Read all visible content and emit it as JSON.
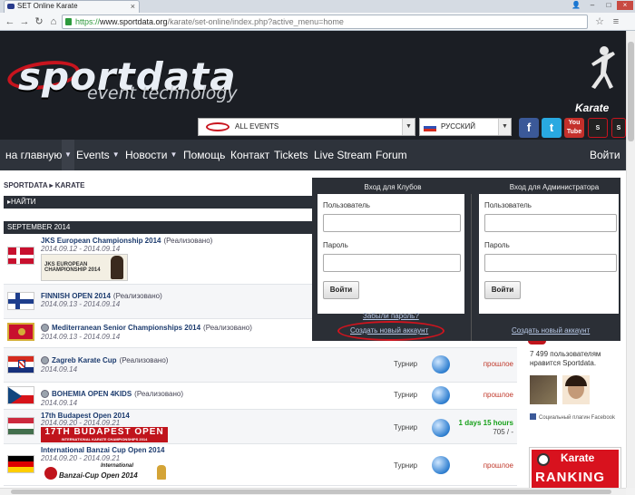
{
  "browser": {
    "tab_title": "SET Online Karate",
    "url_https": "https://",
    "url_host": "www.sportdata.org",
    "url_path": "/karate/set-online/index.php?active_menu=home"
  },
  "header": {
    "logo_main": "sportdata",
    "logo_sub": "event technology",
    "sport_label": "Karate",
    "events_select": "ALL EVENTS",
    "language_select": "РУССКИЙ",
    "social": [
      "f",
      "t",
      "You Tube"
    ]
  },
  "nav": {
    "items": [
      {
        "label": "на главную",
        "caret": true
      },
      {
        "label": "Events",
        "caret": true
      },
      {
        "label": "Новости",
        "caret": true
      },
      {
        "label": "Помощь",
        "caret": false
      },
      {
        "label": "Контакт",
        "caret": false
      },
      {
        "label": "Tickets",
        "caret": false
      },
      {
        "label": "Live Stream",
        "caret": false
      },
      {
        "label": "Forum",
        "caret": false
      }
    ],
    "login": "Войти"
  },
  "breadcrumb": "SPORTDATA ▸ KARATE",
  "search_label": "НАЙТИ",
  "month_label": "SEPTEMBER 2014",
  "events": [
    {
      "name": "JKS European Championship 2014",
      "status": "(Реализовано)",
      "dates": "2014.09.12 - 2014.09.14",
      "type": "",
      "result": "",
      "banner": "JKS EUROPEAN CHAMPIONSHIP 2014",
      "flag": "dk"
    },
    {
      "name": "FINNISH OPEN 2014",
      "status": "(Реализовано)",
      "dates": "2014.09.13 - 2014.09.14",
      "type": "",
      "result": "",
      "banner": "",
      "flag": "fi"
    },
    {
      "name": "Mediterranean Senior Championships 2014",
      "status": "(Реализовано)",
      "dates": "2014.09.13 - 2014.09.14",
      "type": "",
      "result": "",
      "banner": "",
      "flag": "me"
    },
    {
      "name": "Zagreb Karate Cup",
      "status": "(Реализовано)",
      "dates": "2014.09.14",
      "type": "Турнир",
      "result": "прошлое",
      "banner": "",
      "flag": "hr"
    },
    {
      "name": "BOHEMIA OPEN 4KIDS",
      "status": "(Реализовано)",
      "dates": "2014.09.14",
      "type": "Турнир",
      "result": "прошлое",
      "banner": "",
      "flag": "cz"
    },
    {
      "name": "17th Budapest Open 2014",
      "status": "",
      "dates": "2014.09.20 - 2014.09.21",
      "type": "Турнир",
      "result": "1 days 15 hours",
      "result2": "705 / -",
      "banner": "17TH BUDAPEST OPEN",
      "banner_sub": "INTERNATIONAL KARATE CHAMPIONSHIPS 2014",
      "flag": "hu"
    },
    {
      "name": "International Banzai Cup Open 2014",
      "status": "",
      "dates": "2014.09.20 - 2014.09.21",
      "type": "Турнир",
      "result": "прошлое",
      "banner": "International",
      "banner_sub": "Banzai-Cup Open 2014",
      "flag": "de"
    }
  ],
  "login_popup": {
    "clubs_title": "Вход для Клубов",
    "admin_title": "Вход для Администратора",
    "user_label": "Пользователь",
    "password_label": "Пароль",
    "login_button": "Войти",
    "forgot_link": "Забыли пароль?",
    "create_link": "Создать новый аккаунт",
    "create_link_admin": "Создать новый аккаунт"
  },
  "sidebar": {
    "likes_text": "7 499 пользователям нравится Sportdata.",
    "fb_plugin": "Социальный плагин Facebook",
    "ranking_title": "Karate",
    "ranking_word": "RANKING"
  },
  "colors": {
    "header_bg": "#1b1e24",
    "nav_bg": "#2e333b",
    "popup_bg": "#2b2f36",
    "link_blue": "#1c3b6e",
    "past_red": "#c0392b",
    "countdown_green": "#17a01a",
    "highlight_red": "#d0141e"
  }
}
